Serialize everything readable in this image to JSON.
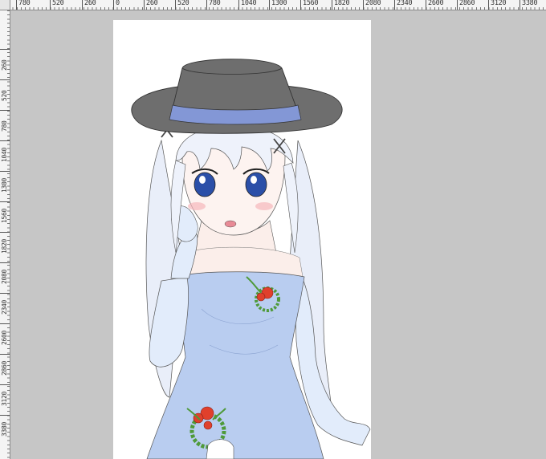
{
  "rulers": {
    "horizontal": [
      "780",
      "520",
      "260",
      "0",
      "260",
      "520",
      "780",
      "1040",
      "1300",
      "1560",
      "1820",
      "2080",
      "2340",
      "2600",
      "2860",
      "3120",
      "3380"
    ],
    "vertical": [
      "260",
      "520",
      "780",
      "1040",
      "1300",
      "1560",
      "1820",
      "2080",
      "2340",
      "2600",
      "2860",
      "3120",
      "3380"
    ]
  },
  "canvas": {
    "background_color": "#c6c6c6",
    "document_color": "#ffffff"
  },
  "artwork": {
    "subject": "anime-girl-sketch",
    "colors": {
      "hat": "#6e6e6e",
      "hat_band": "#8397d6",
      "hair": "#e8eefa",
      "dress": "#b9cdf0",
      "skin": "#fbeeea",
      "eyes": "#2b4fa8",
      "flower": "#e0402c",
      "leaf": "#4f9a3a"
    }
  }
}
